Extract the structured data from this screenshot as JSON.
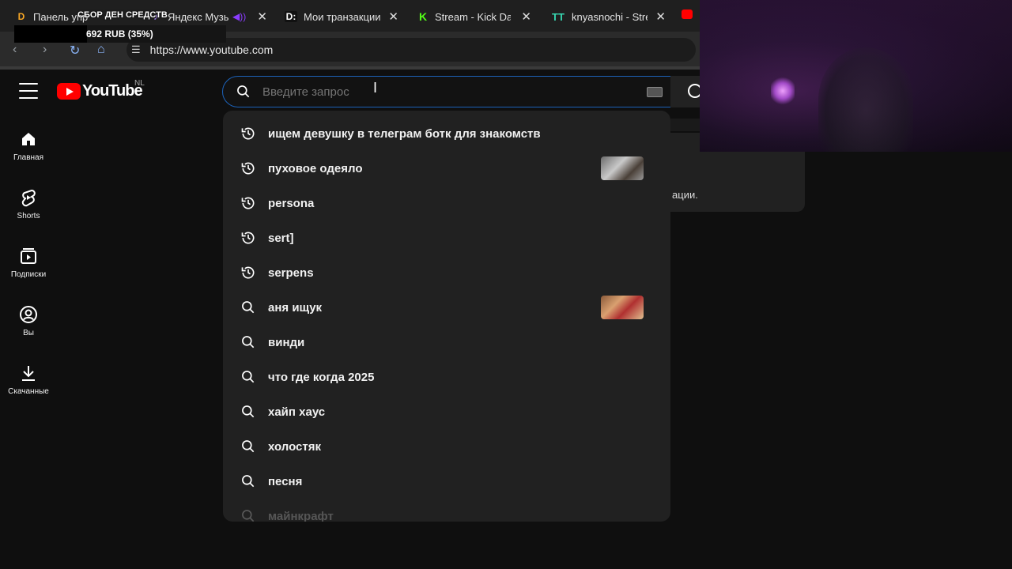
{
  "browser": {
    "tabs": [
      {
        "favicon": "D",
        "favicon_color": "#f9a825",
        "title": "Панель упр"
      },
      {
        "favicon": "",
        "favicon_color": "#7c4dff",
        "title": "Яндекс Музы"
      },
      {
        "favicon": "D:",
        "favicon_color": "#ffffff",
        "title": "Мои транзакции"
      },
      {
        "favicon": "K",
        "favicon_color": "#53fc18",
        "title": "Stream - Kick Dasl"
      },
      {
        "favicon": "TT",
        "favicon_color": "#37d6b0",
        "title": "knyasnochi - Strea"
      }
    ],
    "close_glyph": "✕",
    "address_url": "https://www.youtube.com"
  },
  "donation_overlay": {
    "title": "СБОР ДЕН СРЕДСТВ",
    "progress_text": "692 RUB (35%)",
    "progress_percent": 35
  },
  "youtube": {
    "logo_text": "YouTube",
    "country_code": "NL",
    "search": {
      "placeholder": "Введите запрос"
    },
    "sidebar": [
      {
        "label": "Главная",
        "icon": "home-icon"
      },
      {
        "label": "Shorts",
        "icon": "shorts-icon"
      },
      {
        "label": "Подписки",
        "icon": "subscriptions-icon"
      },
      {
        "label": "Вы",
        "icon": "account-icon"
      },
      {
        "label": "Скачанные",
        "icon": "download-icon"
      }
    ],
    "background_card_text": "ации.",
    "suggestions": [
      {
        "type": "history",
        "text": "ищем девушку в телеграм ботк для знакомств",
        "thumb": false
      },
      {
        "type": "history",
        "text": "пуховое одеяло",
        "thumb": true
      },
      {
        "type": "history",
        "text": "persona",
        "thumb": false
      },
      {
        "type": "history",
        "text": "sert]",
        "thumb": false
      },
      {
        "type": "history",
        "text": "serpens",
        "thumb": false
      },
      {
        "type": "search",
        "text": "аня ищук",
        "thumb": true
      },
      {
        "type": "search",
        "text": "винди",
        "thumb": false
      },
      {
        "type": "search",
        "text": "что где когда 2025",
        "thumb": false
      },
      {
        "type": "search",
        "text": "хайп хаус",
        "thumb": false
      },
      {
        "type": "search",
        "text": "холостяк",
        "thumb": false
      },
      {
        "type": "search",
        "text": "песня",
        "thumb": false
      },
      {
        "type": "search",
        "text": "майнкрафт",
        "thumb": false
      }
    ]
  },
  "colors": {
    "accent_red": "#ff0000",
    "search_focus_border": "#1c62b9",
    "page_bg": "#0f0f0f",
    "dropdown_bg": "#212121"
  }
}
